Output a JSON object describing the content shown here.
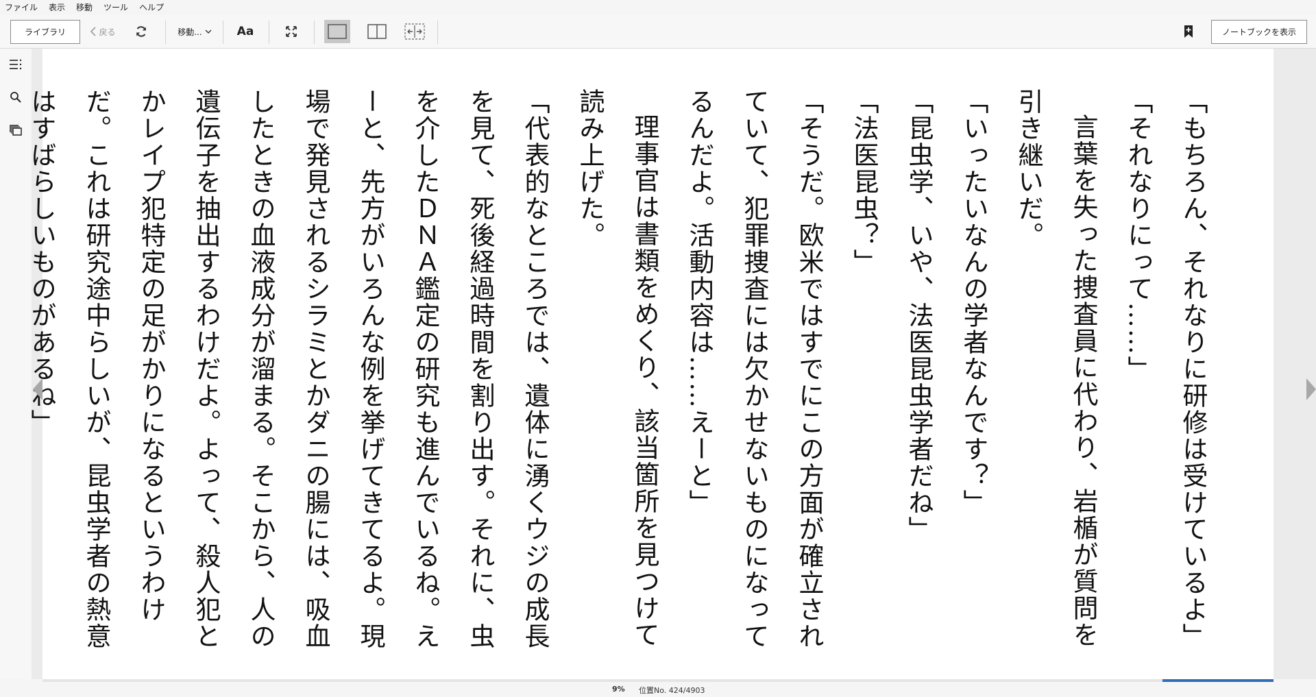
{
  "menu": [
    "ファイル",
    "表示",
    "移動",
    "ツール",
    "ヘルプ"
  ],
  "toolbar": {
    "library_label": "ライブラリ",
    "back_label": "戻る",
    "goto_label": "移動...",
    "font_label": "Aa",
    "notebook_label": "ノートブックを表示"
  },
  "icons": {
    "back": "chevron-left-icon",
    "sync": "sync-icon",
    "goto": "chevron-down-icon",
    "fullscreen": "fullscreen-icon",
    "single_column": "single-column-icon",
    "two_column": "two-column-icon",
    "fit_page": "fit-page-icon",
    "bookmark": "bookmark-add-icon",
    "toc": "table-of-contents-icon",
    "search": "search-icon",
    "flashcards": "flashcards-icon"
  },
  "book": {
    "paragraphs": [
      {
        "text": "「もちろん、それなりに研修は受けているよ」",
        "indent": false
      },
      {
        "text": "「それなりにって……」",
        "indent": false
      },
      {
        "text": "言葉を失った捜査員に代わり、岩楯が質問を引き継いだ。",
        "indent": true
      },
      {
        "text": "「いったいなんの学者なんです？」",
        "indent": false
      },
      {
        "text": "「昆虫学、いや、法医昆虫学者だね」",
        "indent": false
      },
      {
        "text": "「法医昆虫？」",
        "indent": false
      },
      {
        "text": "「そうだ。欧米ではすでにこの方面が確立されていて、犯罪捜査には欠かせないものになってるんだよ。活動内容は……えーと」",
        "indent": false
      },
      {
        "text": "理事官は書類をめくり、該当箇所を見つけて読み上げた。",
        "indent": true
      },
      {
        "text": "「代表的なところでは、遺体に湧くウジの成長を見て、死後経過時間を割り出す。それに、虫を介したＤＮＡ鑑定の研究も進んでいるね。えーと、先方がいろんな例を挙げてきてるよ。現場で発見されるシラミとかダニの腸には、吸血したときの血液成分が溜まる。そこから、人の遺伝子を抽出するわけだよ。よって、殺人犯とかレイプ犯特定の足がかりになるというわけだ。これは研究途中らしいが、昆虫学者の熱意はすばらしいものがあるね」",
        "indent": false
      }
    ]
  },
  "status": {
    "percent": "9%",
    "location": "位置No. 424/4903",
    "progress_fraction": 0.09
  }
}
